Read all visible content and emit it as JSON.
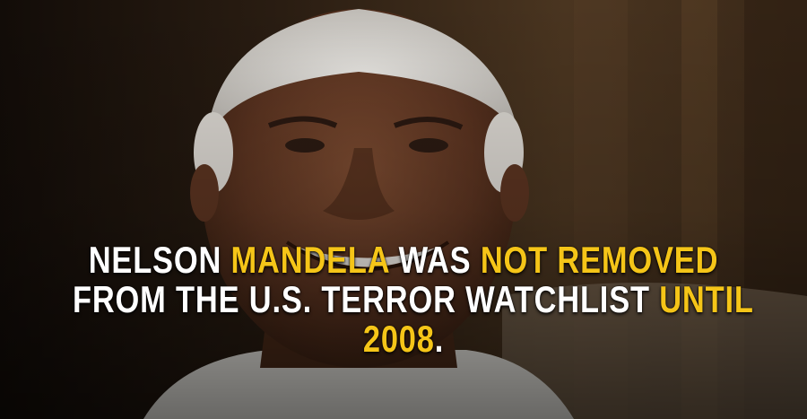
{
  "image": {
    "subject": "photo-portrait",
    "colors": {
      "text_primary": "#ffffff",
      "text_highlight": "#f5c518",
      "background_dark": "#1a130d"
    }
  },
  "caption": {
    "lines": [
      [
        {
          "text": "NELSON ",
          "highlight": false
        },
        {
          "text": "MANDELA",
          "highlight": true
        },
        {
          "text": " WAS ",
          "highlight": false
        },
        {
          "text": "NOT REMOVED",
          "highlight": true
        }
      ],
      [
        {
          "text": "FROM THE U.S. TERROR WATCHLIST ",
          "highlight": false
        },
        {
          "text": "UNTIL",
          "highlight": true
        }
      ],
      [
        {
          "text": "2008",
          "highlight": true
        },
        {
          "text": ".",
          "highlight": false
        }
      ]
    ]
  }
}
